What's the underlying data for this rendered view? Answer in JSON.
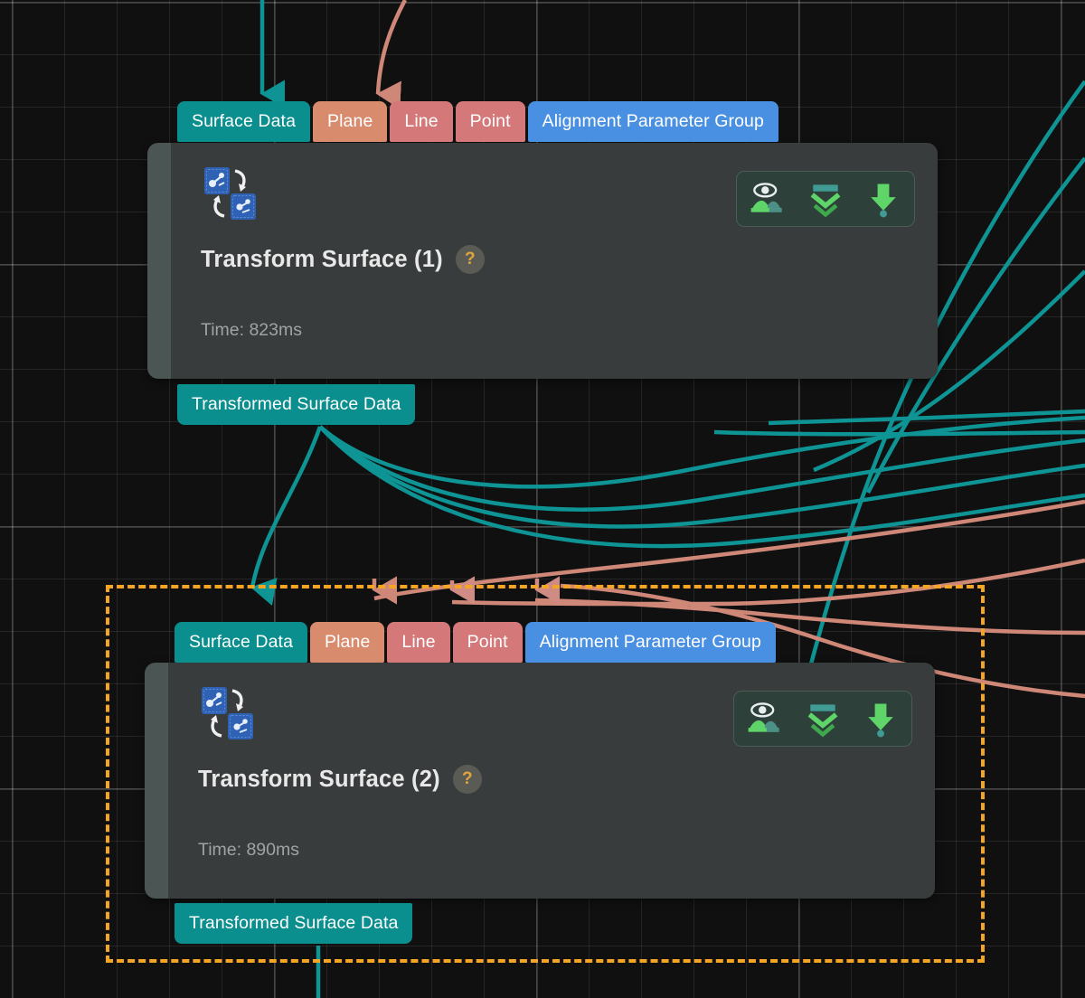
{
  "editor": {
    "name": "node-graph-editor",
    "background_color": "#101010",
    "grid_minor_color": "#1e1e1e",
    "grid_major_color": "#2b2b2b",
    "selection_color": "#f5a524"
  },
  "palette": {
    "surface_data": "#0b8e8e",
    "plane": "#d98b6d",
    "line": "#d4787a",
    "point": "#d4787a",
    "alignment_parameter_group": "#4a90e2",
    "node_body": "#383c3c",
    "node_accent": "#4b5553",
    "edge_teal": "#0e9494",
    "edge_salmon": "#d9877f",
    "tool_green": "#5fd468",
    "tool_teal": "#3f9b94"
  },
  "nodes": [
    {
      "id": "transform-surface-1",
      "title": "Transform Surface (1)",
      "time_label": "Time: 823ms",
      "help_label": "?",
      "selected": false,
      "type_icon": "transform-surface-icon",
      "inputs": [
        {
          "label": "Surface Data",
          "color_key": "teal",
          "connected": true
        },
        {
          "label": "Plane",
          "color_key": "salmon",
          "connected": true
        },
        {
          "label": "Line",
          "color_key": "rose",
          "connected": false
        },
        {
          "label": "Point",
          "color_key": "rose",
          "connected": false
        },
        {
          "label": "Alignment Parameter Group",
          "color_key": "blue",
          "connected": false
        }
      ],
      "outputs": [
        {
          "label": "Transformed Surface Data",
          "color_key": "teal"
        }
      ],
      "tools": [
        {
          "name": "preview-visibility-icon",
          "label": "eye-landscape-icon"
        },
        {
          "name": "collapse-chevrons-icon",
          "label": "double-chevron-down-icon"
        },
        {
          "name": "download-output-icon",
          "label": "arrow-down-dot-icon"
        }
      ]
    },
    {
      "id": "transform-surface-2",
      "title": "Transform Surface (2)",
      "time_label": "Time: 890ms",
      "help_label": "?",
      "selected": true,
      "type_icon": "transform-surface-icon",
      "inputs": [
        {
          "label": "Surface Data",
          "color_key": "teal",
          "connected": true
        },
        {
          "label": "Plane",
          "color_key": "salmon",
          "connected": true
        },
        {
          "label": "Line",
          "color_key": "rose",
          "connected": true
        },
        {
          "label": "Point",
          "color_key": "rose",
          "connected": true
        },
        {
          "label": "Alignment Parameter Group",
          "color_key": "blue",
          "connected": false
        }
      ],
      "outputs": [
        {
          "label": "Transformed Surface Data",
          "color_key": "teal"
        }
      ],
      "tools": [
        {
          "name": "preview-visibility-icon",
          "label": "eye-landscape-icon"
        },
        {
          "name": "collapse-chevrons-icon",
          "label": "double-chevron-down-icon"
        },
        {
          "name": "download-output-icon",
          "label": "arrow-down-dot-icon"
        }
      ]
    }
  ],
  "selection": {
    "name": "selection-marquee",
    "style": "dashed",
    "color": "#f5a524"
  }
}
